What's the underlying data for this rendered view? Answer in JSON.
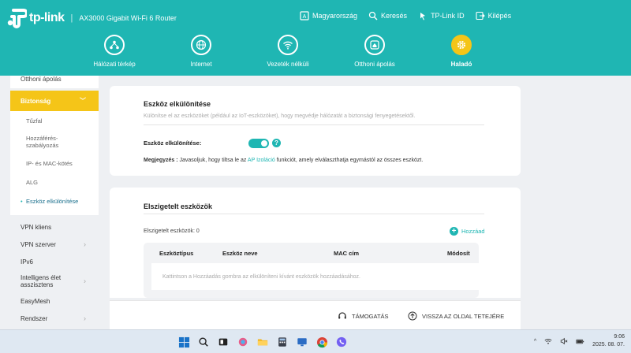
{
  "header": {
    "brand": "tp-link",
    "separator": "|",
    "model": "AX3000 Gigabit Wi-Fi 6 Router",
    "top_links": [
      {
        "label": "Magyarország",
        "icon": "language-icon"
      },
      {
        "label": "Keresés",
        "icon": "search-icon"
      },
      {
        "label": "TP-Link ID",
        "icon": "user-id-icon"
      },
      {
        "label": "Kilépés",
        "icon": "logout-icon"
      }
    ],
    "tabs": [
      {
        "label": "Hálózati térkép",
        "icon": "network-map-icon"
      },
      {
        "label": "Internet",
        "icon": "globe-icon"
      },
      {
        "label": "Vezeték nélküli",
        "icon": "wifi-icon"
      },
      {
        "label": "Otthoni ápolás",
        "icon": "home-care-icon"
      },
      {
        "label": "Haladó",
        "icon": "gear-icon",
        "active": true
      }
    ]
  },
  "sidebar": {
    "top_item": "Otthoni ápolás",
    "security": {
      "label": "Biztonság",
      "children": [
        "Tűzfal",
        "Hozzáférés-szabályozás",
        "IP- és MAC-kötés",
        "ALG",
        "Eszköz elkülönítése"
      ]
    },
    "items": [
      "VPN kliens",
      "VPN szerver",
      "IPv6",
      "Intelligens élet asszisztens",
      "EasyMesh",
      "Rendszer"
    ]
  },
  "isolation": {
    "title": "Eszköz elkülönítése",
    "description": "Különítse el az eszközöket (például az IoT-eszközöket), hogy megvédje hálózatát a biztonsági fenyegetésektől.",
    "toggle_label": "Eszköz elkülönítése:",
    "toggle_on": true,
    "note_prefix": "Megjegyzés :",
    "note_before": " Javasoljuk, hogy tiltsa le az ",
    "note_link": "AP Izoláció",
    "note_after": " funkciót, amely elválaszthatja egymástól az összes eszközt."
  },
  "isolated_devices": {
    "title": "Elszigetelt eszközök",
    "count_label": "Elszigetelt eszközök: 0",
    "add_label": "Hozzáad",
    "columns": [
      "Eszköztípus",
      "Eszköz neve",
      "MAC cím",
      "Módosít"
    ],
    "empty_text": "Kattintson a Hozzáadás gombra az elkülöníteni kívánt eszközök hozzáadásához."
  },
  "footer": {
    "support": "TÁMOGATÁS",
    "back_to_top": "VISSZA AZ OLDAL TETEJÉRE"
  },
  "taskbar": {
    "time": "9:06",
    "date": "2025. 08. 07.",
    "tray_chevron": "^"
  },
  "colors": {
    "header": "#1fb6b3",
    "accent": "#f5c518",
    "link": "#1fb6b3"
  }
}
